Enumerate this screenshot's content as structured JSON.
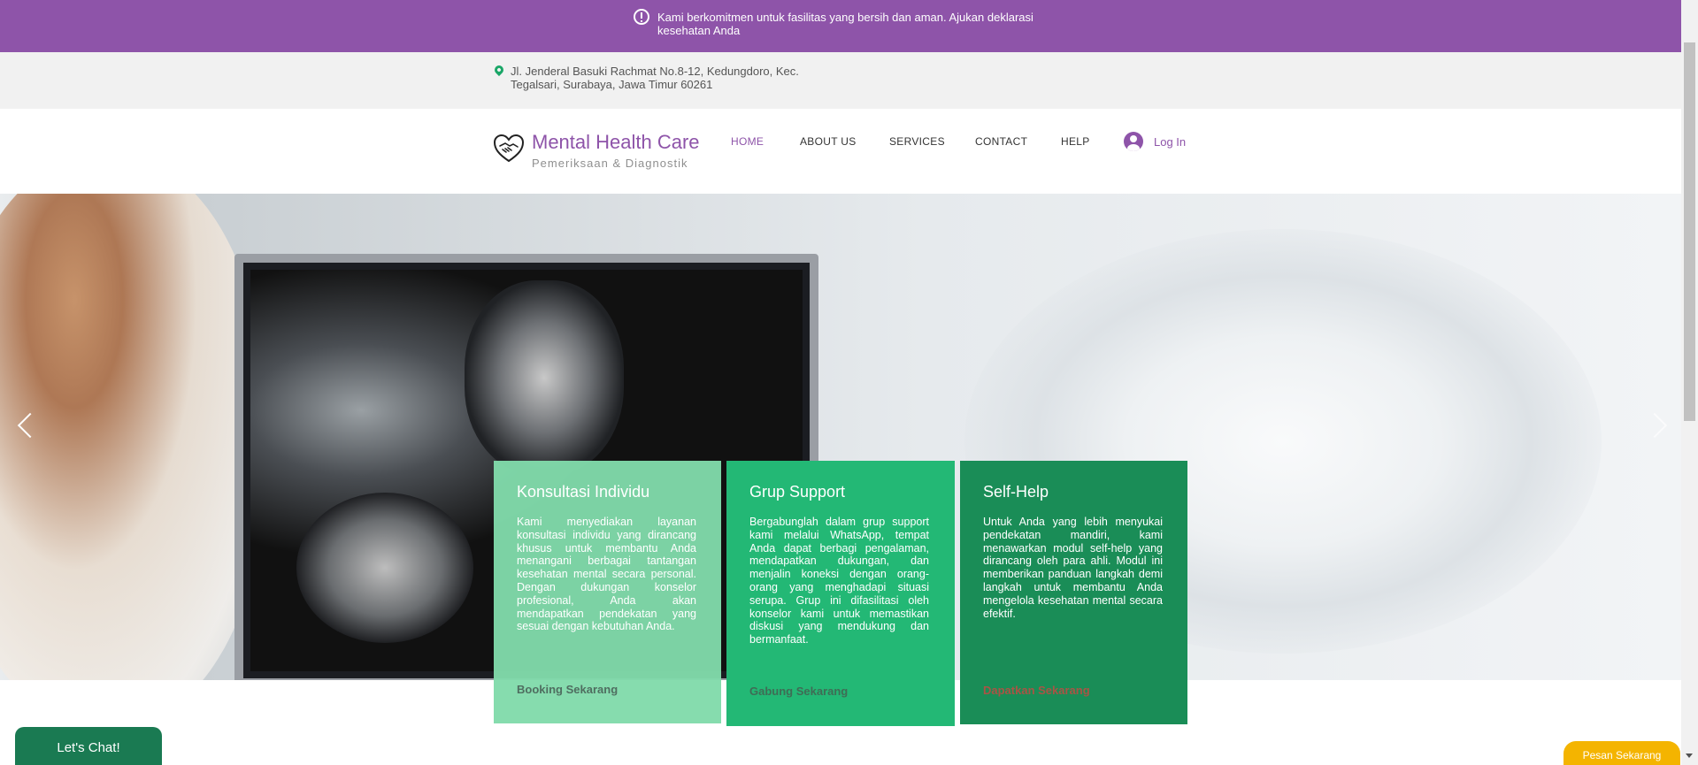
{
  "announcement": {
    "text": "Kami berkomitmen untuk fasilitas yang bersih dan aman. Ajukan deklarasi kesehatan Anda",
    "icon": "info-icon"
  },
  "address": {
    "text": "Jl. Jenderal Basuki Rachmat No.8-12, Kedungdoro, Kec. Tegalsari, Surabaya, Jawa Timur 60261",
    "icon": "location-pin-icon"
  },
  "header": {
    "brand": "Mental Health Care",
    "tagline": "Pemeriksaan & Diagnostik",
    "logo_icon": "handshake-heart-icon",
    "nav": [
      {
        "label": "HOME",
        "active": true
      },
      {
        "label": "ABOUT US",
        "active": false
      },
      {
        "label": "SERVICES",
        "active": false
      },
      {
        "label": "CONTACT",
        "active": false
      },
      {
        "label": "HELP",
        "active": false
      }
    ],
    "login_label": "Log In"
  },
  "hero": {
    "prev_icon": "chevron-left-icon",
    "next_icon": "chevron-right-icon"
  },
  "cards": [
    {
      "title": "Konsultasi Individu",
      "body": "Kami menyediakan layanan konsultasi individu yang dirancang khusus untuk membantu Anda menangani berbagai tantangan kesehatan mental secara personal. Dengan dukungan konselor profesional, Anda akan mendapatkan pendekatan yang sesuai dengan kebutuhan Anda.",
      "cta": "Booking Sekarang"
    },
    {
      "title": "Grup Support",
      "body": "Bergabunglah dalam grup support kami melalui WhatsApp, tempat Anda dapat berbagi pengalaman, mendapatkan dukungan, dan menjalin koneksi dengan orang-orang yang menghadapi situasi serupa. Grup ini difasilitasi oleh konselor kami untuk memastikan diskusi yang mendukung dan bermanfaat.",
      "cta": "Gabung Sekarang"
    },
    {
      "title": "Self-Help",
      "body": "Untuk Anda yang lebih menyukai pendekatan mandiri, kami menawarkan modul self-help yang dirancang oleh para ahli. Modul ini memberikan panduan langkah demi langkah untuk membantu Anda mengelola kesehatan mental secara efektif.",
      "cta": "Dapatkan Sekarang"
    }
  ],
  "chat_label": "Let's Chat!",
  "order_label": "Pesan Sekarang",
  "colors": {
    "brand_purple": "#8e54a9",
    "card_light": "#81dbab",
    "card_mid": "#23b875",
    "card_dark": "#1a8d57",
    "chat_green": "#1a7a52",
    "order_yellow": "#f4b400"
  }
}
